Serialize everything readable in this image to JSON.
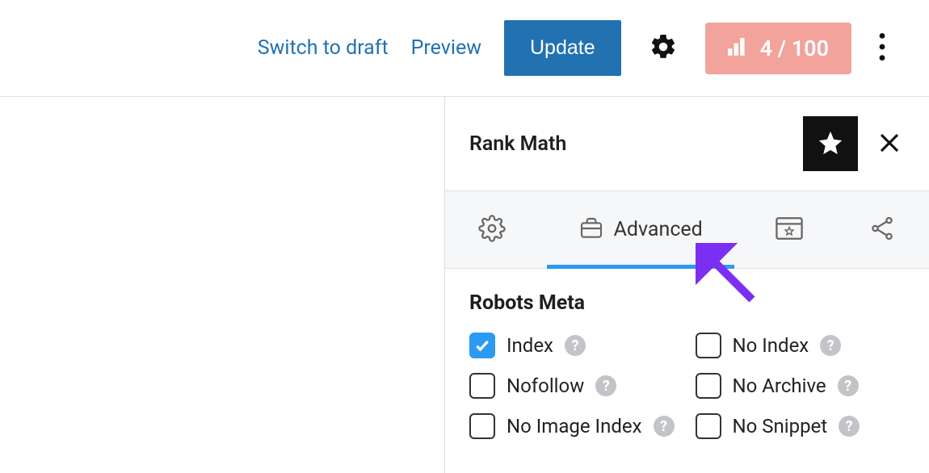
{
  "toolbar": {
    "switch_to_draft": "Switch to draft",
    "preview": "Preview",
    "update": "Update",
    "score": "4 / 100"
  },
  "panel": {
    "title": "Rank Math",
    "tabs": {
      "general": "",
      "advanced": "Advanced",
      "schema": "",
      "social": ""
    }
  },
  "section": {
    "title": "Robots Meta",
    "items": {
      "index": "Index",
      "nofollow": "Nofollow",
      "noimageindex": "No Image Index",
      "noindex": "No Index",
      "noarchive": "No Archive",
      "nosnippet": "No Snippet"
    }
  }
}
